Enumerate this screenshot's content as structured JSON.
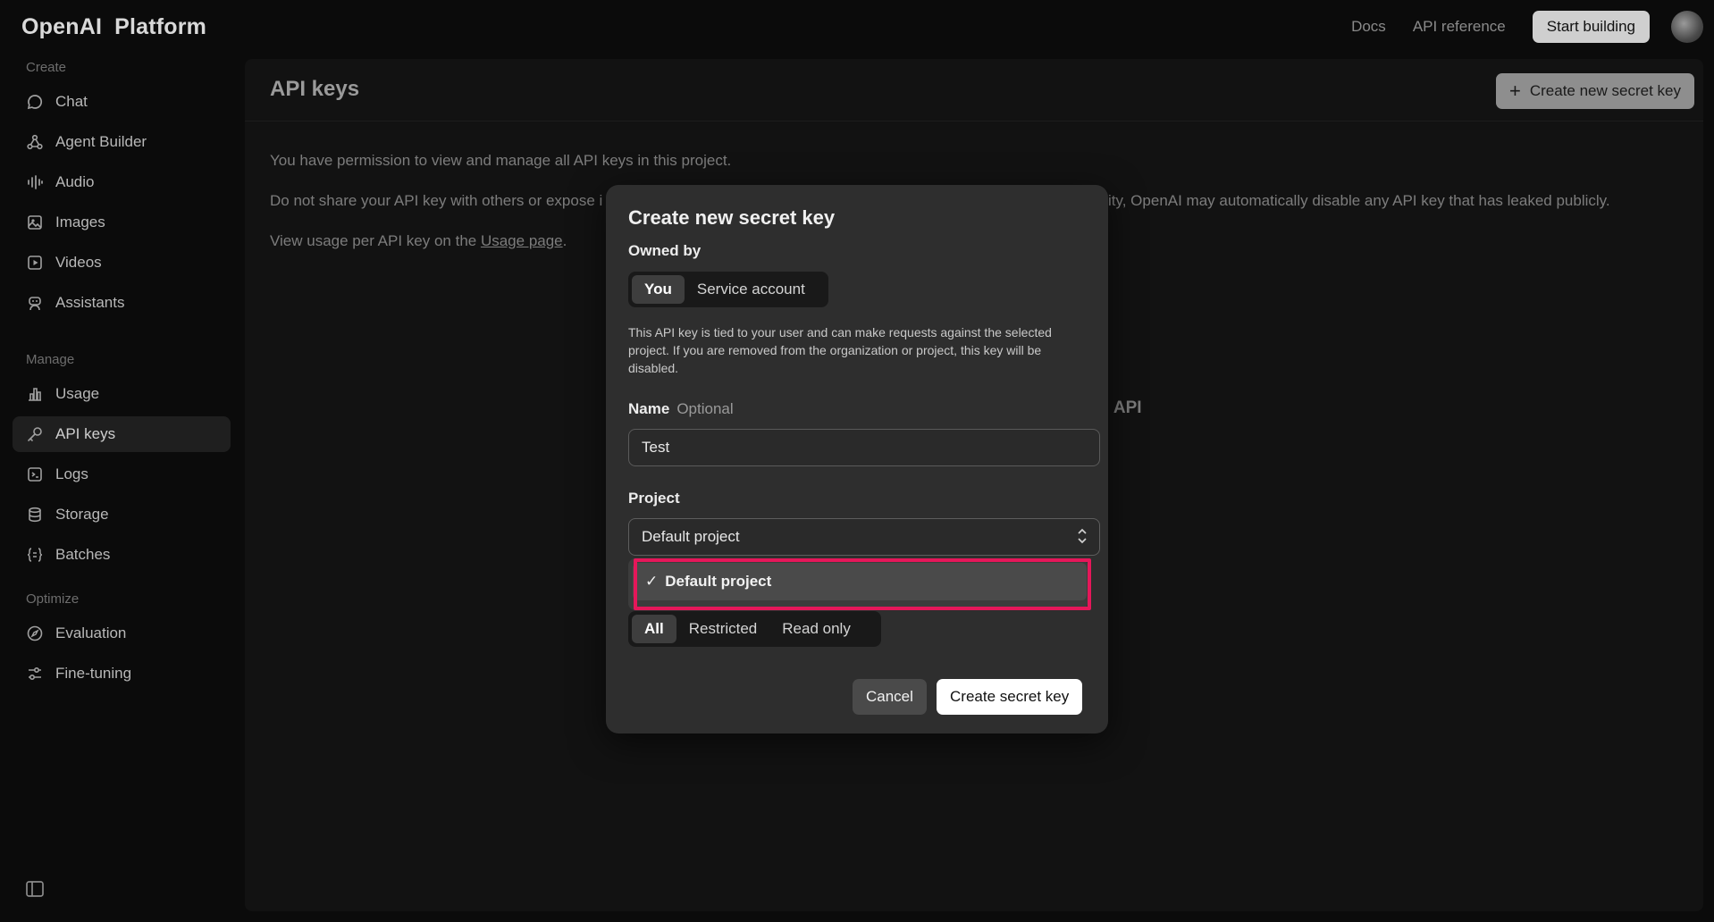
{
  "brand": {
    "name": "OpenAI",
    "product": "Platform"
  },
  "topnav": {
    "docs": "Docs",
    "api_reference": "API reference",
    "start_building": "Start building"
  },
  "sidebar": {
    "sections": [
      "Create",
      "Manage",
      "Optimize"
    ],
    "items": [
      {
        "label": "Chat",
        "icon": "chat-bubble-icon"
      },
      {
        "label": "Agent Builder",
        "icon": "agent-builder-icon"
      },
      {
        "label": "Audio",
        "icon": "audio-wave-icon"
      },
      {
        "label": "Images",
        "icon": "image-icon"
      },
      {
        "label": "Videos",
        "icon": "video-icon"
      },
      {
        "label": "Assistants",
        "icon": "assistant-robot-icon"
      },
      {
        "label": "Usage",
        "icon": "bar-chart-icon"
      },
      {
        "label": "API keys",
        "icon": "key-icon",
        "active": true
      },
      {
        "label": "Logs",
        "icon": "terminal-icon"
      },
      {
        "label": "Storage",
        "icon": "database-icon"
      },
      {
        "label": "Batches",
        "icon": "braces-icon"
      },
      {
        "label": "Evaluation",
        "icon": "compass-icon"
      },
      {
        "label": "Fine-tuning",
        "icon": "sliders-icon"
      }
    ]
  },
  "main": {
    "title": "API keys",
    "create_button": "Create new secret key",
    "para1": "You have permission to view and manage all API keys in this project.",
    "para2_start": "Do not share your API key with others or expose i",
    "para2_end": "ity, OpenAI may automatically disable any API key that has leaked publicly.",
    "para3_prefix": "View usage per API key on the ",
    "para3_link": "Usage page",
    "para3_suffix": ".",
    "bg_heading_fragment": "I API"
  },
  "modal": {
    "title": "Create new secret key",
    "owned_by_label": "Owned by",
    "owner_options": [
      "You",
      "Service account"
    ],
    "owner_selected": "You",
    "description": "This API key is tied to your user and can make requests against the selected project. If you are removed from the organization or project, this key will be disabled.",
    "name_label": "Name",
    "name_optional": "Optional",
    "name_value": "Test",
    "project_label": "Project",
    "project_value": "Default project",
    "dropdown_option": "Default project",
    "dropdown_check": "✓",
    "permission_options": [
      "All",
      "Restricted",
      "Read only"
    ],
    "permission_selected": "All",
    "cancel": "Cancel",
    "create": "Create secret key"
  },
  "colors": {
    "highlight": "#e5175a",
    "panel": "#121212",
    "modal": "#2e2e2e"
  }
}
